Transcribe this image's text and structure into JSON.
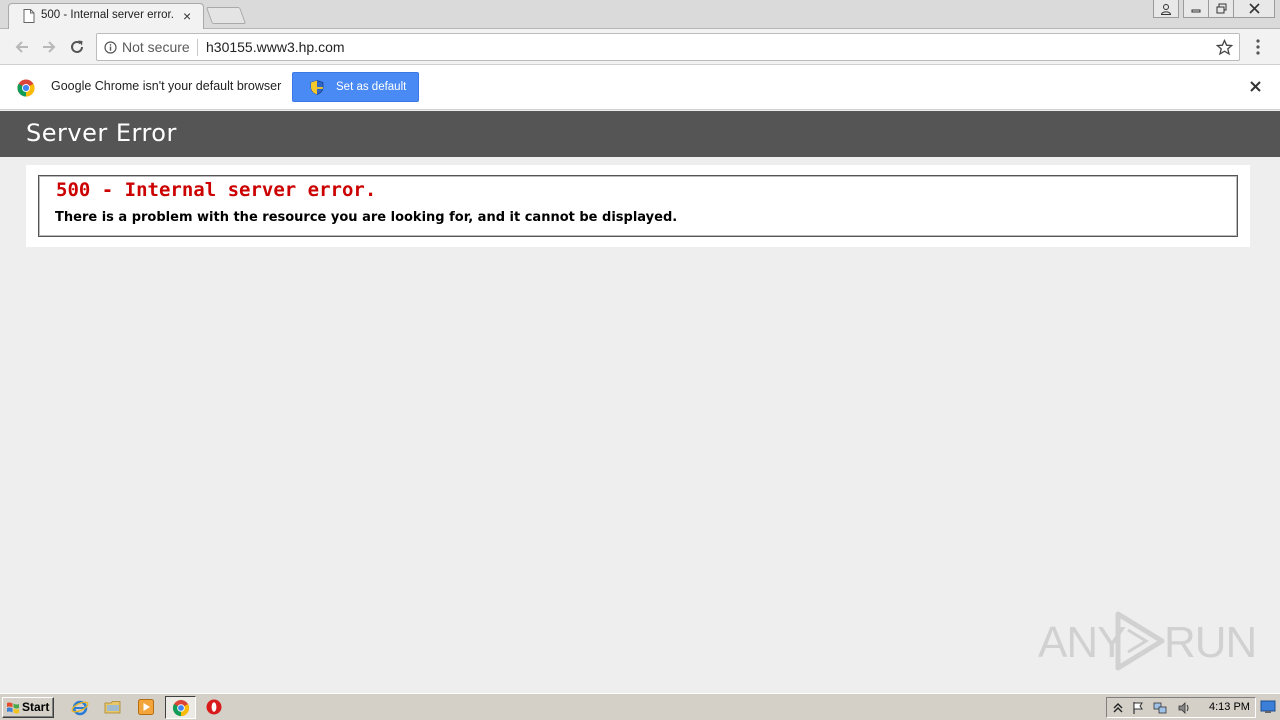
{
  "browser": {
    "tab": {
      "title": "500 - Internal server error.",
      "close": "×"
    },
    "omnibox": {
      "security": "Not secure",
      "url": "h30155.www3.hp.com"
    },
    "infobar": {
      "message": "Google Chrome isn't your default browser",
      "button": "Set as default"
    }
  },
  "page": {
    "header": "Server Error",
    "error_title": "500 - Internal server error.",
    "error_message": "There is a problem with the resource you are looking for, and it cannot be displayed."
  },
  "watermark": {
    "left": "ANY",
    "right": "RUN"
  },
  "taskbar": {
    "start": "Start",
    "clock": "4:13 PM"
  },
  "colors": {
    "header_bg": "#555555",
    "error_red": "#cc0000",
    "button_blue": "#4a8af4",
    "page_bg": "#eeeeee"
  }
}
